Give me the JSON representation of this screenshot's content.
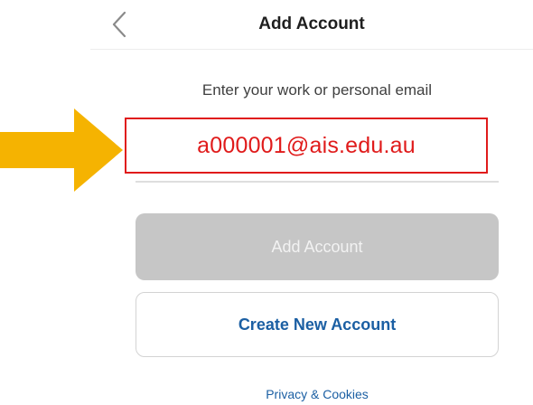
{
  "header": {
    "title": "Add Account",
    "back_icon": "chevron-left-icon"
  },
  "form": {
    "prompt": "Enter your work or personal email",
    "email_value": "a000001@ais.edu.au",
    "add_button_label": "Add Account",
    "create_button_label": "Create New Account"
  },
  "footer": {
    "privacy_link": "Privacy & Cookies"
  },
  "annotation": {
    "arrow_icon": "arrow-right-icon",
    "arrow_color": "#f5b301",
    "highlight_color": "#e01b1b"
  },
  "colors": {
    "accent_blue": "#1b5fa3",
    "disabled_button": "#c6c6c6"
  }
}
